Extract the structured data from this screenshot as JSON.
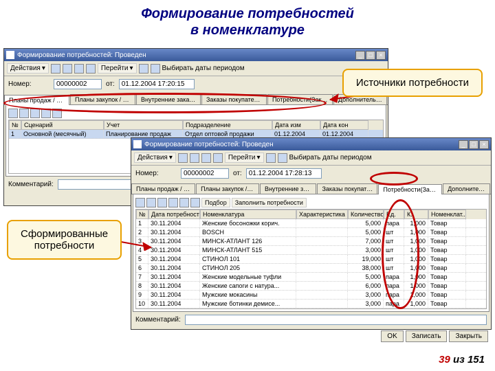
{
  "slide": {
    "title_l1": "Формирование потребностей",
    "title_l2": "в номенклатуре",
    "callout_sources": "Источники потребности",
    "callout_formed_l1": "Сформированные",
    "callout_formed_l2": "потребности",
    "page_cur": "39",
    "page_sep": " из ",
    "page_total": "151"
  },
  "win1": {
    "title": "Формирование потребностей: Проведен",
    "actions": "Действия",
    "nav": "Перейти",
    "date_hint": "Выбирать даты периодом",
    "num_lbl": "Номер:",
    "num_val": "00000002",
    "date_lbl": "от:",
    "date_val": "01.12.2004 17:20:15",
    "tabs": [
      "Планы продаж / Пла...",
      "Планы закупок / Ост...",
      "Внутренние заказы",
      "Заказы покупателе...",
      "Потребности(Закупк..)",
      "Дополнительно"
    ],
    "grid_head": [
      "№",
      "Сценарий",
      "Учет",
      "Подразделение",
      "Дата изм",
      "Дата кон"
    ],
    "row": {
      "n": "1",
      "scen": "Основной (месячный)",
      "uch": "Планирование продаж",
      "dep": "Отдел оптовой продажи",
      "d1": "01.12.2004",
      "d2": "01.12.2004"
    },
    "comment_lbl": "Комментарий:"
  },
  "win2": {
    "title": "Формирование потребностей: Проведен",
    "actions": "Действия",
    "nav": "Перейти",
    "date_hint": "Выбирать даты периодом",
    "num_lbl": "Номер:",
    "num_val": "00000002",
    "date_lbl": "от:",
    "date_val": "01.12.2004 17:28:13",
    "tabs": [
      "Планы продаж / Пла...",
      "Планы закупок / Ост...",
      "Внутренние заказы",
      "Заказы покупателе...",
      "Потребности(Закупк..)",
      "Дополнительно"
    ],
    "podbor": "Подбор",
    "fill": "Заполнить потребности",
    "grid_head": [
      "№",
      "Дата потребности",
      "Номенклатура",
      "Характеристика",
      "Количество",
      "Ед.",
      "К.",
      "Номенклат..."
    ],
    "rows": [
      {
        "n": "1",
        "d": "30.11.2004",
        "nom": "Женские босоножки корич.",
        "q": "5,000",
        "u": "пара",
        "k": "1,000",
        "t": "Товар"
      },
      {
        "n": "2",
        "d": "30.11.2004",
        "nom": "BOSCH",
        "q": "5,000",
        "u": "шт",
        "k": "1,000",
        "t": "Товар"
      },
      {
        "n": "3",
        "d": "30.11.2004",
        "nom": "МИНСК-АТЛАНТ 126",
        "q": "7,000",
        "u": "шт",
        "k": "1,000",
        "t": "Товар"
      },
      {
        "n": "4",
        "d": "30.11.2004",
        "nom": "МИНСК-АТЛАНТ 515",
        "q": "3,000",
        "u": "шт",
        "k": "1,000",
        "t": "Товар"
      },
      {
        "n": "5",
        "d": "30.11.2004",
        "nom": "СТИНОЛ 101",
        "q": "19,000",
        "u": "шт",
        "k": "1,000",
        "t": "Товар"
      },
      {
        "n": "6",
        "d": "30.11.2004",
        "nom": "СТИНОЛ 205",
        "q": "38,000",
        "u": "шт",
        "k": "1,000",
        "t": "Товар"
      },
      {
        "n": "7",
        "d": "30.11.2004",
        "nom": "Женские модельные туфли",
        "q": "5,000",
        "u": "пара",
        "k": "1,000",
        "t": "Товар"
      },
      {
        "n": "8",
        "d": "30.11.2004",
        "nom": "Женские сапоги с натура...",
        "q": "6,000",
        "u": "пара",
        "k": "1,000",
        "t": "Товар"
      },
      {
        "n": "9",
        "d": "30.11.2004",
        "nom": "Мужские мокасины",
        "q": "3,000",
        "u": "пара",
        "k": "1,000",
        "t": "Товар"
      },
      {
        "n": "10",
        "d": "30.11.2004",
        "nom": "Мужские ботинки демисе...",
        "q": "3,000",
        "u": "пара",
        "k": "1,000",
        "t": "Товар"
      }
    ],
    "comment_lbl": "Комментарий:",
    "btn_ok": "OK",
    "btn_save": "Записать",
    "btn_close": "Закрыть"
  }
}
